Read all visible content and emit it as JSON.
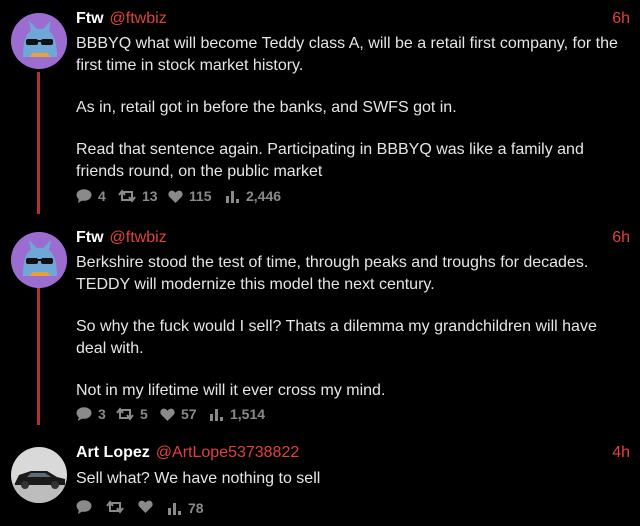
{
  "colors": {
    "accent": "#e0423a",
    "thread_line": "#b3312e",
    "background": "#000000",
    "muted": "#8a8a8a"
  },
  "tweets": [
    {
      "name": "Ftw",
      "handle": "@ftwbiz",
      "time": "6h",
      "paragraphs": [
        "BBBYQ what will become Teddy class A, will be a retail first company, for the first time in stock market history.",
        "As in, retail got in before the banks, and SWFS got in.",
        "Read that sentence again. Participating in BBBYQ was like a family and friends round, on the public market"
      ],
      "replies": "4",
      "retweets": "13",
      "likes": "115",
      "views": "2,446"
    },
    {
      "name": "Ftw",
      "handle": "@ftwbiz",
      "time": "6h",
      "paragraphs": [
        "Berkshire stood the test of time, through peaks and troughs for decades. TEDDY will modernize this model the next century.",
        "So why the fuck would I sell? Thats a dilemma my grandchildren will have deal with.",
        "Not in my lifetime will it ever cross my mind."
      ],
      "replies": "3",
      "retweets": "5",
      "likes": "57",
      "views": "1,514"
    },
    {
      "name": "Art Lopez",
      "handle": "@ArtLope53738822",
      "time": "4h",
      "paragraphs": [
        "Sell what? We have nothing to sell"
      ],
      "replies": "",
      "retweets": "",
      "likes": "",
      "views": "78"
    }
  ]
}
